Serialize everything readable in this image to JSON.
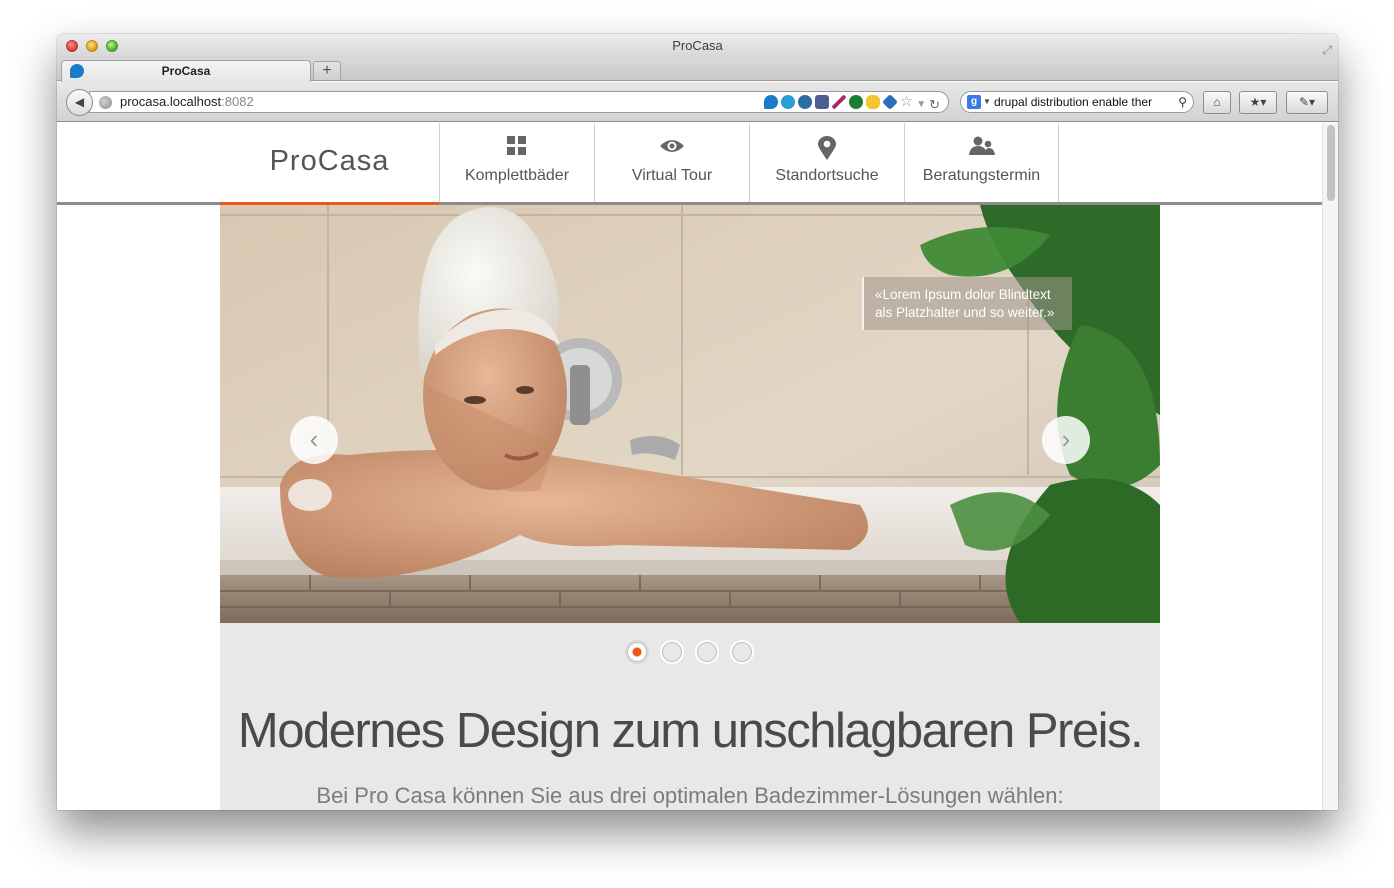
{
  "window": {
    "title": "ProCasa"
  },
  "tab": {
    "label": "ProCasa",
    "new_tab_symbol": "+"
  },
  "address_bar": {
    "host": "procasa.localhost",
    "port": ":8082"
  },
  "search_bar": {
    "query": "drupal distribution enable ther"
  },
  "site": {
    "logo": "ProCasa",
    "nav": [
      {
        "label": "Komplettbäder",
        "icon": "grid-icon"
      },
      {
        "label": "Virtual Tour",
        "icon": "eye-icon"
      },
      {
        "label": "Standortsuche",
        "icon": "map-pin-icon"
      },
      {
        "label": "Beratungstermin",
        "icon": "people-icon"
      }
    ]
  },
  "hero": {
    "quote_line1": "«Lorem Ipsum dolor Blindtext",
    "quote_line2": "als Platzhalter und so weiter.»",
    "prev_symbol": "‹",
    "next_symbol": "›",
    "slide_count": 4,
    "active_slide": 1
  },
  "content": {
    "headline": "Modernes Design zum unschlagbaren Preis.",
    "subline": "Bei Pro Casa können Sie aus drei optimalen Badezimmer-Lösungen wählen:"
  },
  "colors": {
    "accent": "#e8591a",
    "text": "#4a4a4a",
    "band": "#e8e8e8"
  }
}
